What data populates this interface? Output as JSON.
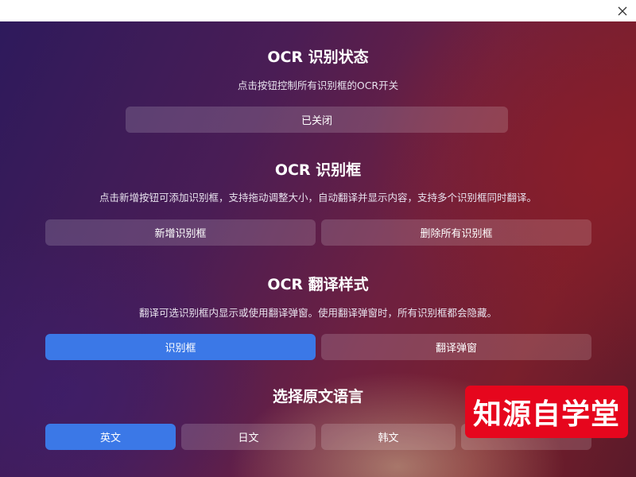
{
  "window": {
    "close_icon": "close-icon"
  },
  "ocr_status": {
    "title": "OCR 识别状态",
    "description": "点击按钮控制所有识别框的OCR开关",
    "toggle_label": "已关闭"
  },
  "ocr_box": {
    "title": "OCR 识别框",
    "description": "点击新增按钮可添加识别框，支持拖动调整大小，自动翻译并显示内容，支持多个识别框同时翻译。",
    "add_label": "新增识别框",
    "delete_all_label": "删除所有识别框"
  },
  "translation_style": {
    "title": "OCR 翻译样式",
    "description": "翻译可选识别框内显示或使用翻译弹窗。使用翻译弹窗时，所有识别框都会隐藏。",
    "options": [
      "识别框",
      "翻译弹窗"
    ],
    "selected": "识别框"
  },
  "source_language": {
    "title": "选择原文语言",
    "options": [
      "英文",
      "日文",
      "韩文"
    ],
    "selected": "英文"
  },
  "watermark": {
    "text": "知源自学堂",
    "color": "#e6061d"
  },
  "colors": {
    "accent": "#3b78e7"
  }
}
